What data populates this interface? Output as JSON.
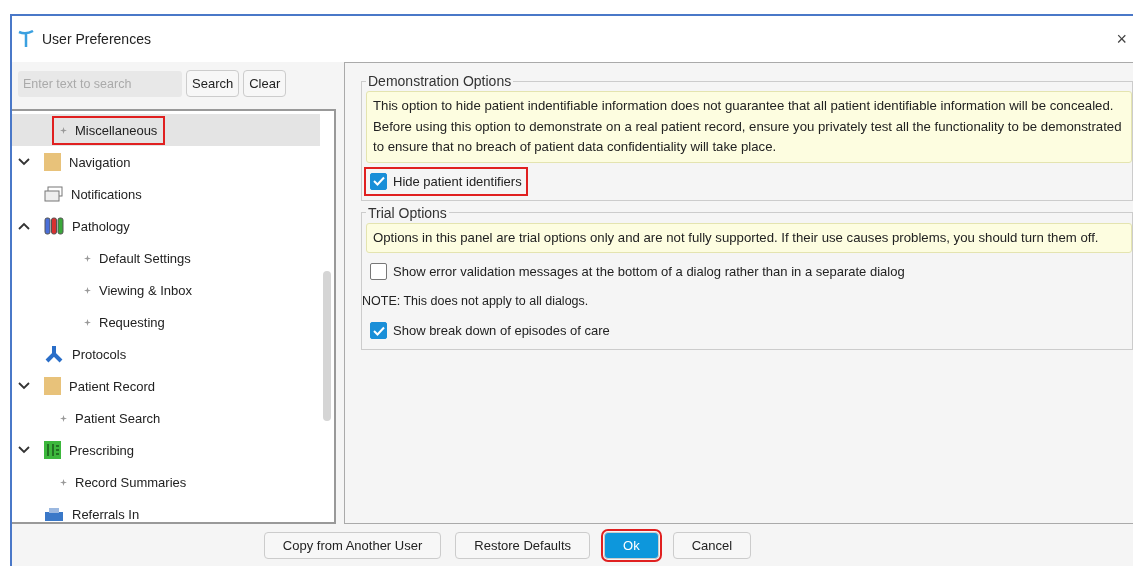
{
  "window": {
    "title": "User Preferences",
    "close": "×"
  },
  "search": {
    "placeholder": "Enter text to search",
    "buttons": [
      "Search",
      "Clear"
    ]
  },
  "tree": [
    {
      "label": "Miscellaneous",
      "kind": "bullet",
      "selected": true,
      "highlighted": true
    },
    {
      "label": "Navigation",
      "kind": "folder",
      "selected": false,
      "highlighted": false,
      "expanded": false
    },
    {
      "label": "Notifications",
      "kind": "tray",
      "selected": false,
      "highlighted": false
    },
    {
      "label": "Pathology",
      "kind": "tubes",
      "selected": false,
      "highlighted": false,
      "expanded": true,
      "children": [
        {
          "label": "Default Settings",
          "kind": "bullet",
          "selected": false,
          "highlighted": false
        },
        {
          "label": "Viewing & Inbox",
          "kind": "bullet",
          "selected": false,
          "highlighted": false
        },
        {
          "label": "Requesting",
          "kind": "bullet",
          "selected": false,
          "highlighted": false
        }
      ]
    },
    {
      "label": "Protocols",
      "kind": "branch",
      "selected": false,
      "highlighted": false
    },
    {
      "label": "Patient Record",
      "kind": "folder",
      "selected": false,
      "highlighted": false,
      "expanded": false
    },
    {
      "label": "Patient Search",
      "kind": "bullet",
      "selected": false,
      "highlighted": false
    },
    {
      "label": "Prescribing",
      "kind": "grid",
      "selected": false,
      "highlighted": false,
      "expanded": false
    },
    {
      "label": "Record Summaries",
      "kind": "bullet",
      "selected": false,
      "highlighted": false
    },
    {
      "label": "Referrals In",
      "kind": "printer",
      "selected": false,
      "highlighted": false
    }
  ],
  "groups": [
    {
      "title": "Demonstration Options",
      "items": [
        {
          "kind": "notice",
          "text": "This option to hide patient indentifiable information does not guarantee that all patient identifiable information will be concealed. Before using this option to demonstrate on a real patient record, ensure you privately test all the functionality to be demonstrated to ensure that no breach of patient data confidentiality will take place."
        },
        {
          "kind": "checkbox",
          "label": "Hide patient identifiers",
          "checked": true,
          "highlighted": true
        }
      ]
    },
    {
      "title": "Trial Options",
      "items": [
        {
          "kind": "notice",
          "text": "Options in this panel are trial options only and are not fully supported. If their use causes problems, you should turn them off."
        },
        {
          "kind": "checkbox",
          "label": "Show error validation messages at the bottom of a dialog rather than in a separate dialog",
          "checked": false,
          "highlighted": false
        },
        {
          "kind": "note",
          "text": "NOTE: This does not apply to all dialogs."
        },
        {
          "kind": "checkbox",
          "label": "Show break down of episodes of care",
          "checked": true,
          "highlighted": false
        }
      ]
    }
  ],
  "buttons": [
    {
      "label": "Copy from Another User",
      "primary": false,
      "highlighted": false
    },
    {
      "label": "Restore Defaults",
      "primary": false,
      "highlighted": false
    },
    {
      "label": "Ok",
      "primary": true,
      "highlighted": true
    },
    {
      "label": "Cancel",
      "primary": false,
      "highlighted": false
    }
  ]
}
